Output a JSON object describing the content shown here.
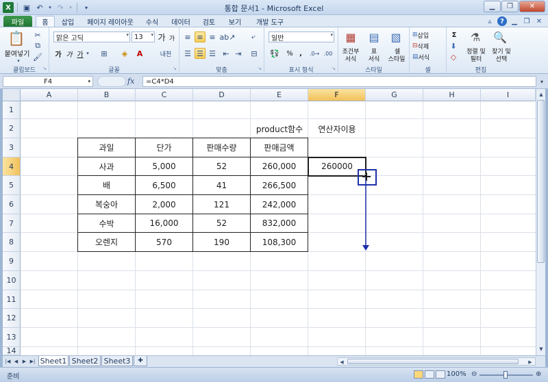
{
  "window": {
    "title": "통합 문서1 - Microsoft Excel"
  },
  "tabs": [
    "파일",
    "홈",
    "삽입",
    "페이지 레이아웃",
    "수식",
    "데이터",
    "검토",
    "보기",
    "개발 도구"
  ],
  "ribbon": {
    "clipboard": {
      "paste": "붙여넣기",
      "label": "클립보드"
    },
    "font": {
      "name": "맑은 고딕",
      "size": "13",
      "grow": "가",
      "shrink": "가",
      "bold": "가",
      "italic": "가",
      "underline": "가",
      "label": "글꼴"
    },
    "align": {
      "label": "맞춤"
    },
    "number": {
      "format": "일반",
      "percent": "%",
      "comma": ",",
      "label": "표시 형식"
    },
    "styles": {
      "cond": "조건부\n서식",
      "cond_a": "조건부",
      "cond_b": "서식",
      "table_a": "표",
      "table_b": "서식",
      "cell_a": "셀",
      "cell_b": "스타일",
      "label": "스타일"
    },
    "cells": {
      "insert": "삽입",
      "delete": "삭제",
      "format": "서식",
      "label": "셀"
    },
    "edit": {
      "sum": "Σ",
      "sort_a": "정렬 및",
      "sort_b": "필터",
      "find_a": "찾기 및",
      "find_b": "선택",
      "label": "편집"
    }
  },
  "formula_bar": {
    "name_box": "F4",
    "fx": "fx",
    "formula": "=C4*D4"
  },
  "columns": [
    "A",
    "B",
    "C",
    "D",
    "E",
    "F",
    "G",
    "H",
    "I"
  ],
  "rows": [
    "1",
    "2",
    "3",
    "4",
    "5",
    "6",
    "7",
    "8",
    "9",
    "10",
    "11",
    "12",
    "13",
    "14"
  ],
  "cells": {
    "E2": "product함수",
    "F2": "연산자이용",
    "F4": "260000"
  },
  "table": {
    "headers": [
      "과일",
      "단가",
      "판매수량",
      "판매금액"
    ],
    "rows": [
      [
        "사과",
        "5,000",
        "52",
        "260,000"
      ],
      [
        "배",
        "6,500",
        "41",
        "266,500"
      ],
      [
        "복숭아",
        "2,000",
        "121",
        "242,000"
      ],
      [
        "수박",
        "16,000",
        "52",
        "832,000"
      ],
      [
        "오렌지",
        "570",
        "190",
        "108,300"
      ]
    ]
  },
  "sheet_tabs": [
    "Sheet1",
    "Sheet2",
    "Sheet3"
  ],
  "status": {
    "ready": "준비",
    "zoom": "100%"
  },
  "colors": {
    "annotation": "#1d2fa8",
    "selection_header": "#f1c15a",
    "file_tab": "#217533"
  }
}
